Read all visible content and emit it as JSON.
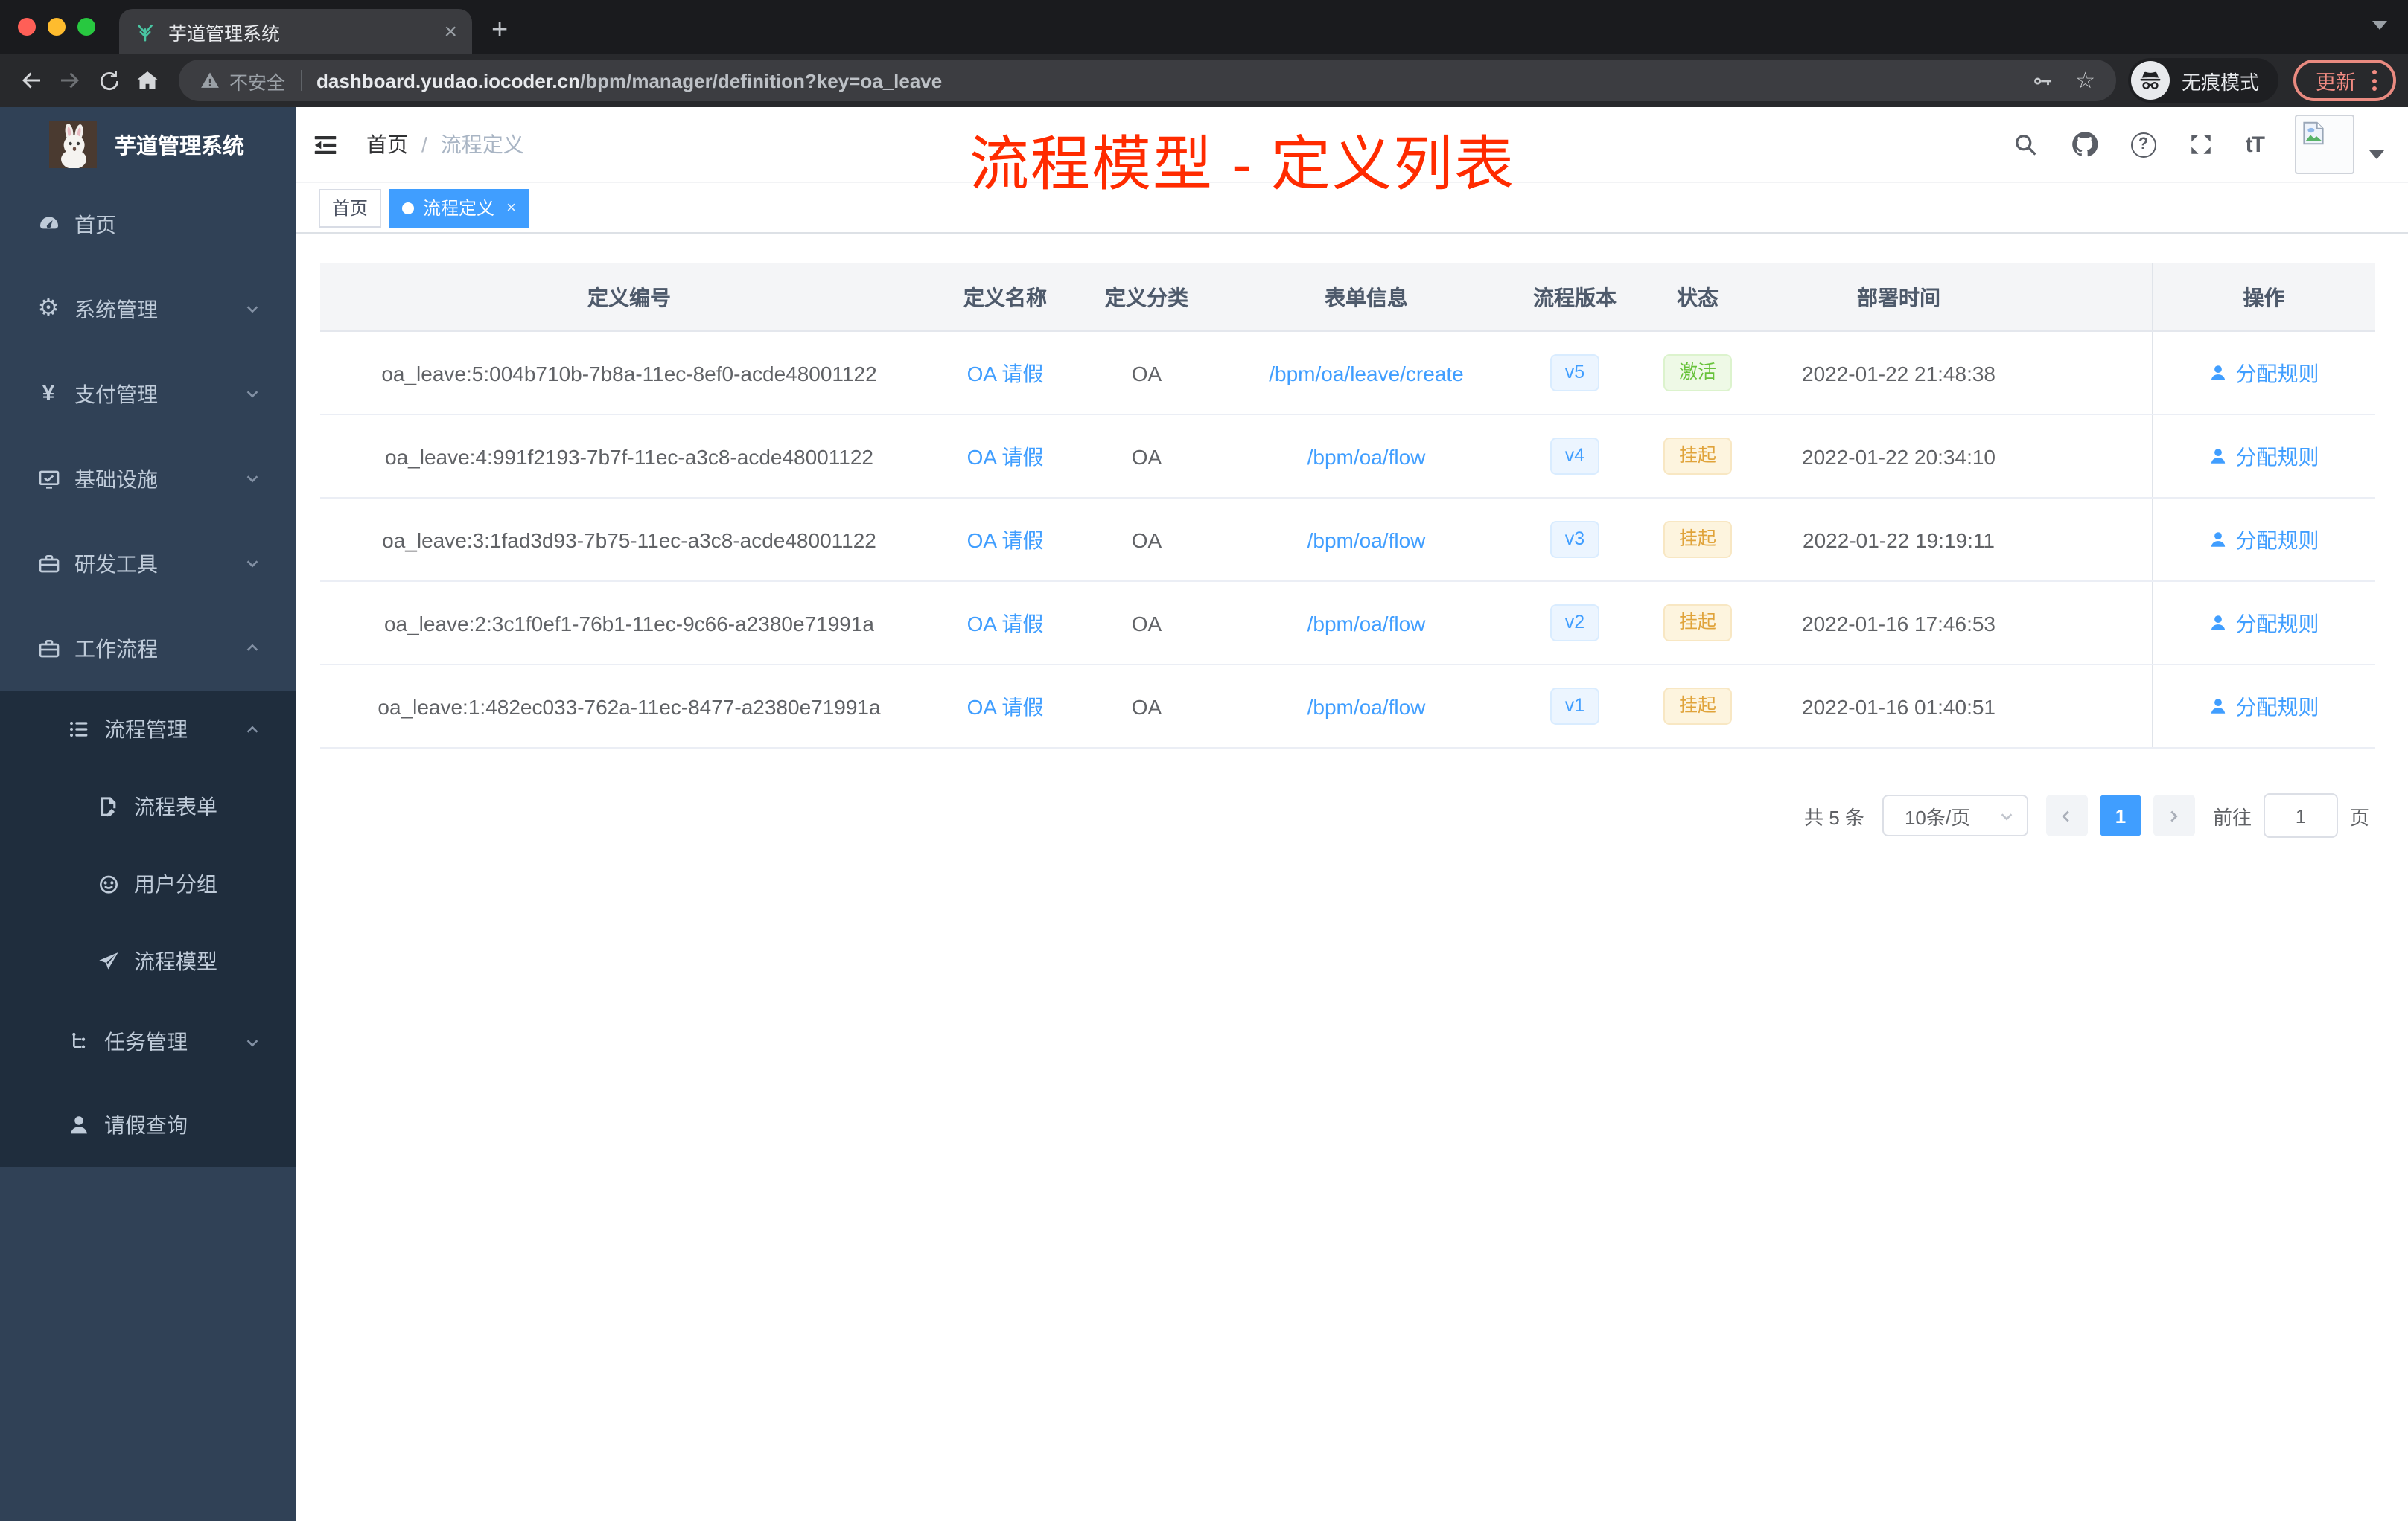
{
  "browser": {
    "tab_title": "芋道管理系统",
    "security_label": "不安全",
    "url_domain": "dashboard.yudao.iocoder.cn",
    "url_path": "/bpm/manager/definition?key=oa_leave",
    "incognito_label": "无痕模式",
    "update_label": "更新"
  },
  "icons": {
    "close": "×",
    "plus": "+",
    "star": "☆",
    "gear": "⚙",
    "yen": "¥"
  },
  "sidebar": {
    "logo_title": "芋道管理系统",
    "items": [
      {
        "label": "首页",
        "icon": "dashboard-icon",
        "level": 1,
        "arrow": "none",
        "dark": false
      },
      {
        "label": "系统管理",
        "icon": "gear-icon",
        "level": 1,
        "arrow": "down",
        "dark": false
      },
      {
        "label": "支付管理",
        "icon": "yen-icon",
        "level": 1,
        "arrow": "down",
        "dark": false
      },
      {
        "label": "基础设施",
        "icon": "monitor-icon",
        "level": 1,
        "arrow": "down",
        "dark": false
      },
      {
        "label": "研发工具",
        "icon": "toolbox-icon",
        "level": 1,
        "arrow": "down",
        "dark": false
      },
      {
        "label": "工作流程",
        "icon": "briefcase-icon",
        "level": 1,
        "arrow": "up",
        "dark": false
      },
      {
        "label": "流程管理",
        "icon": "list-icon",
        "level": 2,
        "arrow": "up",
        "dark": true
      },
      {
        "label": "流程表单",
        "icon": "form-icon",
        "level": 3,
        "arrow": "none",
        "dark": true
      },
      {
        "label": "用户分组",
        "icon": "robot-icon",
        "level": 3,
        "arrow": "none",
        "dark": true
      },
      {
        "label": "流程模型",
        "icon": "send-icon",
        "level": 3,
        "arrow": "none",
        "dark": true
      },
      {
        "label": "任务管理",
        "icon": "tasks-icon",
        "level": 2,
        "arrow": "down",
        "dark": true
      },
      {
        "label": "请假查询",
        "icon": "user-icon",
        "level": 2,
        "arrow": "none",
        "dark": true
      }
    ]
  },
  "navbar": {
    "breadcrumb_home": "首页",
    "breadcrumb_separator": "/",
    "breadcrumb_current": "流程定义",
    "help_glyph": "?",
    "font_glyph": "tT",
    "annotation": "流程模型 - 定义列表"
  },
  "tags": {
    "home": "首页",
    "active": "流程定义"
  },
  "table": {
    "columns": [
      "定义编号",
      "定义名称",
      "定义分类",
      "表单信息",
      "流程版本",
      "状态",
      "部署时间",
      "操作"
    ],
    "rows": [
      {
        "id": "oa_leave:5:004b710b-7b8a-11ec-8ef0-acde48001122",
        "name": "OA 请假",
        "category": "OA",
        "form": "/bpm/oa/leave/create",
        "version": "v5",
        "status": "激活",
        "status_type": "success",
        "deploy_time": "2022-01-22 21:48:38",
        "action": "分配规则"
      },
      {
        "id": "oa_leave:4:991f2193-7b7f-11ec-a3c8-acde48001122",
        "name": "OA 请假",
        "category": "OA",
        "form": "/bpm/oa/flow",
        "version": "v4",
        "status": "挂起",
        "status_type": "warning",
        "deploy_time": "2022-01-22 20:34:10",
        "action": "分配规则"
      },
      {
        "id": "oa_leave:3:1fad3d93-7b75-11ec-a3c8-acde48001122",
        "name": "OA 请假",
        "category": "OA",
        "form": "/bpm/oa/flow",
        "version": "v3",
        "status": "挂起",
        "status_type": "warning",
        "deploy_time": "2022-01-22 19:19:11",
        "action": "分配规则"
      },
      {
        "id": "oa_leave:2:3c1f0ef1-76b1-11ec-9c66-a2380e71991a",
        "name": "OA 请假",
        "category": "OA",
        "form": "/bpm/oa/flow",
        "version": "v2",
        "status": "挂起",
        "status_type": "warning",
        "deploy_time": "2022-01-16 17:46:53",
        "action": "分配规则"
      },
      {
        "id": "oa_leave:1:482ec033-762a-11ec-8477-a2380e71991a",
        "name": "OA 请假",
        "category": "OA",
        "form": "/bpm/oa/flow",
        "version": "v1",
        "status": "挂起",
        "status_type": "warning",
        "deploy_time": "2022-01-16 01:40:51",
        "action": "分配规则"
      }
    ]
  },
  "pagination": {
    "total": "共 5 条",
    "page_size": "10条/页",
    "page": "1",
    "goto_label": "前往",
    "goto_value": "1",
    "page_unit": "页"
  },
  "colors": {
    "accent": "#409eff",
    "success": "#67c23a",
    "warning": "#e6a23c",
    "annotation": "#ff2b00",
    "sidebar": "#304156",
    "sidebar_submenu": "#1f2d3d"
  }
}
